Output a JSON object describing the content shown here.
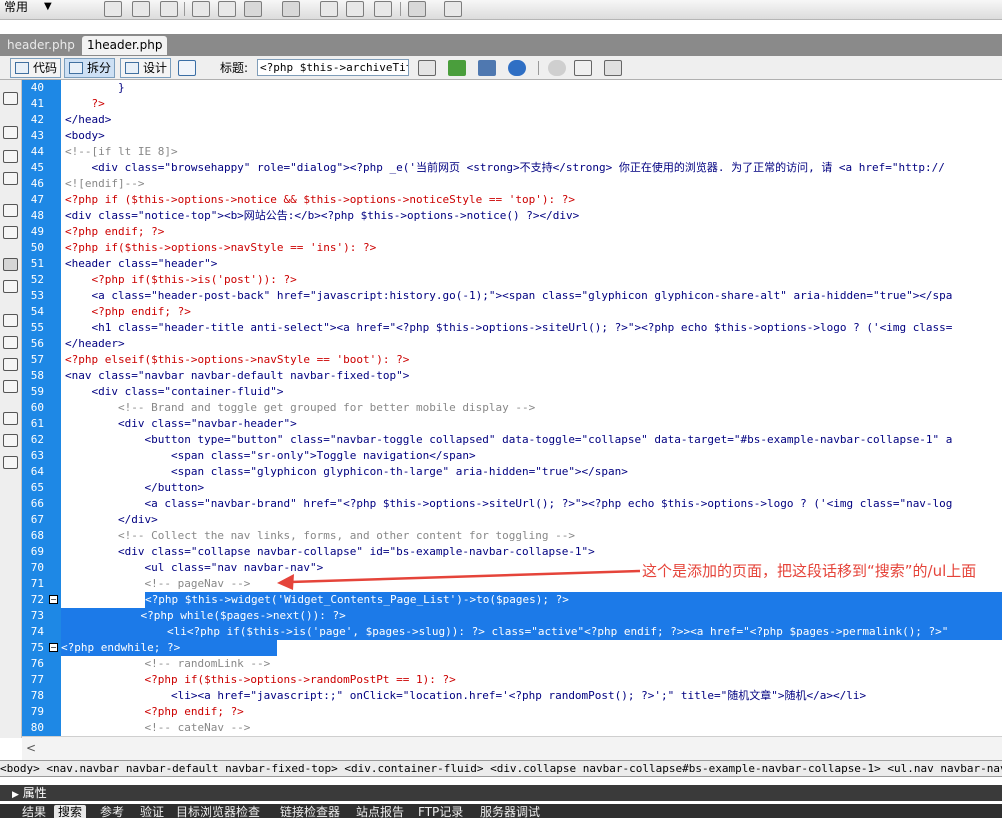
{
  "toolbar_top": {
    "workspace": "常用"
  },
  "tabs": [
    {
      "label": "header.php",
      "active": false
    },
    {
      "label": "1header.php",
      "active": true
    }
  ],
  "doc_toolbar": {
    "code_label": "代码",
    "split_label": "拆分",
    "design_label": "设计",
    "title_label": "标题:",
    "title_value": "<?php $this->archiveTitle"
  },
  "editor": {
    "line_numbers": [
      "40",
      "41",
      "42",
      "43",
      "44",
      "45",
      "46",
      "47",
      "48",
      "49",
      "50",
      "51",
      "52",
      "53",
      "54",
      "55",
      "56",
      "57",
      "58",
      "59",
      "60",
      "61",
      "62",
      "63",
      "64",
      "65",
      "66",
      "67",
      "68",
      "69",
      "70",
      "71",
      "72",
      "73",
      "74",
      "75",
      "76",
      "77",
      "78",
      "79",
      "80"
    ],
    "lines": [
      "        }",
      "    ?>",
      "</head>",
      "<body>",
      "<!--[if lt IE 8]>",
      "    <div class=\"browsehappy\" role=\"dialog\"><?php _e('当前网页 <strong>不支持</strong> 你正在使用的浏览器. 为了正常的访问, 请 <a href=\"http://",
      "<![endif]-->",
      "<?php if ($this->options->notice && $this->options->noticeStyle == 'top'): ?>",
      "<div class=\"notice-top\"><b>网站公告:</b><?php $this->options->notice() ?></div>",
      "<?php endif; ?>",
      "<?php if($this->options->navStyle == 'ins'): ?>",
      "<header class=\"header\">",
      "    <?php if($this->is('post')): ?>",
      "    <a class=\"header-post-back\" href=\"javascript:history.go(-1);\"><span class=\"glyphicon glyphicon-share-alt\" aria-hidden=\"true\"></spa",
      "    <?php endif; ?>",
      "    <h1 class=\"header-title anti-select\"><a href=\"<?php $this->options->siteUrl(); ?>\"><?php echo $this->options->logo ? ('<img class=",
      "</header>",
      "<?php elseif($this->options->navStyle == 'boot'): ?>",
      "<nav class=\"navbar navbar-default navbar-fixed-top\">",
      "    <div class=\"container-fluid\">",
      "        <!-- Brand and toggle get grouped for better mobile display -->",
      "        <div class=\"navbar-header\">",
      "            <button type=\"button\" class=\"navbar-toggle collapsed\" data-toggle=\"collapse\" data-target=\"#bs-example-navbar-collapse-1\" a",
      "                <span class=\"sr-only\">Toggle navigation</span>",
      "                <span class=\"glyphicon glyphicon-th-large\" aria-hidden=\"true\"></span>",
      "            </button>",
      "            <a class=\"navbar-brand\" href=\"<?php $this->options->siteUrl(); ?>\"><?php echo $this->options->logo ? ('<img class=\"nav-log",
      "        </div>",
      "        <!-- Collect the nav links, forms, and other content for toggling -->",
      "        <div class=\"collapse navbar-collapse\" id=\"bs-example-navbar-collapse-1\">",
      "            <ul class=\"nav navbar-nav\">",
      "            <!-- pageNav -->",
      "            <?php $this->widget('Widget_Contents_Page_List')->to($pages); ?>",
      "            <?php while($pages->next()): ?>",
      "                <li<?php if($this->is('page', $pages->slug)): ?> class=\"active\"<?php endif; ?>><a href=\"<?php $pages->permalink(); ?>\"",
      "            <?php endwhile; ?>",
      "            <!-- randomLink -->",
      "            <?php if($this->options->randomPostPt == 1): ?>",
      "                <li><a href=\"javascript:;\" onClick=\"location.href='<?php randomPost(); ?>';\" title=\"随机文章\">随机</a></li>",
      "            <?php endif; ?>",
      "            <!-- cateNav -->"
    ],
    "selected_rows": [
      32,
      33,
      34,
      35
    ]
  },
  "annotation": {
    "text": "这个是添加的页面，把这段话移到“搜索”的/ul上面"
  },
  "scroll": {
    "left_arrow": "<"
  },
  "breadcrumb": {
    "text": "<body> <nav.navbar navbar-default navbar-fixed-top> <div.container-fluid> <div.collapse navbar-collapse#bs-example-navbar-collapse-1> <ul.nav navbar-nav>"
  },
  "properties_panel": {
    "label": "属性",
    "toggle": "▶"
  },
  "bottom_tabs": [
    "结果",
    "搜索",
    "参考",
    "验证",
    "目标浏览器检查",
    "链接检查器",
    "站点报告",
    "FTP记录",
    "服务器调试"
  ],
  "bottom_tab_active": "搜索",
  "colors": {
    "selection": "#1c7ae8",
    "gutter": "#1e88e5",
    "annotation": "#e5443a",
    "tag": "#000080",
    "php": "#cc0000",
    "comment": "#888888"
  }
}
